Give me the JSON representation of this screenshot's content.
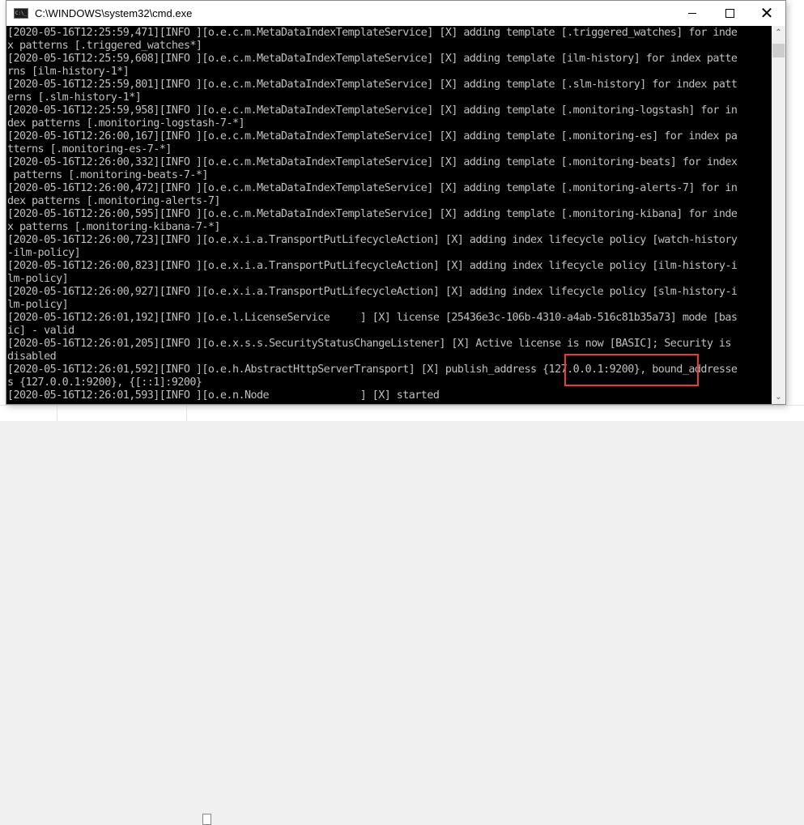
{
  "window": {
    "title": "C:\\WINDOWS\\system32\\cmd.exe",
    "icon": "cmd-icon",
    "icon_text": "C:\\_",
    "controls": {
      "minimize": "minimize-icon",
      "maximize": "maximize-icon",
      "close": "close-icon",
      "close_glyph": "✕"
    }
  },
  "console": {
    "lines": [
      "[2020-05-16T12:25:59,471][INFO ][o.e.c.m.MetaDataIndexTemplateService] [X] adding template [.triggered_watches] for inde",
      "x patterns [.triggered_watches*]",
      "[2020-05-16T12:25:59,608][INFO ][o.e.c.m.MetaDataIndexTemplateService] [X] adding template [ilm-history] for index patte",
      "rns [ilm-history-1*]",
      "[2020-05-16T12:25:59,801][INFO ][o.e.c.m.MetaDataIndexTemplateService] [X] adding template [.slm-history] for index patt",
      "erns [.slm-history-1*]",
      "[2020-05-16T12:25:59,958][INFO ][o.e.c.m.MetaDataIndexTemplateService] [X] adding template [.monitoring-logstash] for in",
      "dex patterns [.monitoring-logstash-7-*]",
      "[2020-05-16T12:26:00,167][INFO ][o.e.c.m.MetaDataIndexTemplateService] [X] adding template [.monitoring-es] for index pa",
      "tterns [.monitoring-es-7-*]",
      "[2020-05-16T12:26:00,332][INFO ][o.e.c.m.MetaDataIndexTemplateService] [X] adding template [.monitoring-beats] for index",
      " patterns [.monitoring-beats-7-*]",
      "[2020-05-16T12:26:00,472][INFO ][o.e.c.m.MetaDataIndexTemplateService] [X] adding template [.monitoring-alerts-7] for in",
      "dex patterns [.monitoring-alerts-7]",
      "[2020-05-16T12:26:00,595][INFO ][o.e.c.m.MetaDataIndexTemplateService] [X] adding template [.monitoring-kibana] for inde",
      "x patterns [.monitoring-kibana-7-*]",
      "[2020-05-16T12:26:00,723][INFO ][o.e.x.i.a.TransportPutLifecycleAction] [X] adding index lifecycle policy [watch-history",
      "-ilm-policy]",
      "[2020-05-16T12:26:00,823][INFO ][o.e.x.i.a.TransportPutLifecycleAction] [X] adding index lifecycle policy [ilm-history-i",
      "lm-policy]",
      "[2020-05-16T12:26:00,927][INFO ][o.e.x.i.a.TransportPutLifecycleAction] [X] adding index lifecycle policy [slm-history-i",
      "lm-policy]",
      "[2020-05-16T12:26:01,192][INFO ][o.e.l.LicenseService     ] [X] license [25436e3c-106b-4310-a4ab-516c81b35a73] mode [bas",
      "ic] - valid",
      "[2020-05-16T12:26:01,205][INFO ][o.e.x.s.s.SecurityStatusChangeListener] [X] Active license is now [BASIC]; Security is",
      "disabled",
      "[2020-05-16T12:26:01,592][INFO ][o.e.h.AbstractHttpServerTransport] [X] publish_address {127.0.0.1:9200}, bound_addresse",
      "s {127.0.0.1:9200}, {[::1]:9200}",
      "[2020-05-16T12:26:01,593][INFO ][o.e.n.Node               ] [X] started"
    ],
    "highlighted_value": "{127.0.0.1:9200}",
    "highlight_color": "#e83c3c",
    "text_color": "#c0c0c0",
    "background_color": "#000000"
  },
  "scrollbar": {
    "up_glyph": "⌃",
    "down_glyph": "⌄"
  }
}
